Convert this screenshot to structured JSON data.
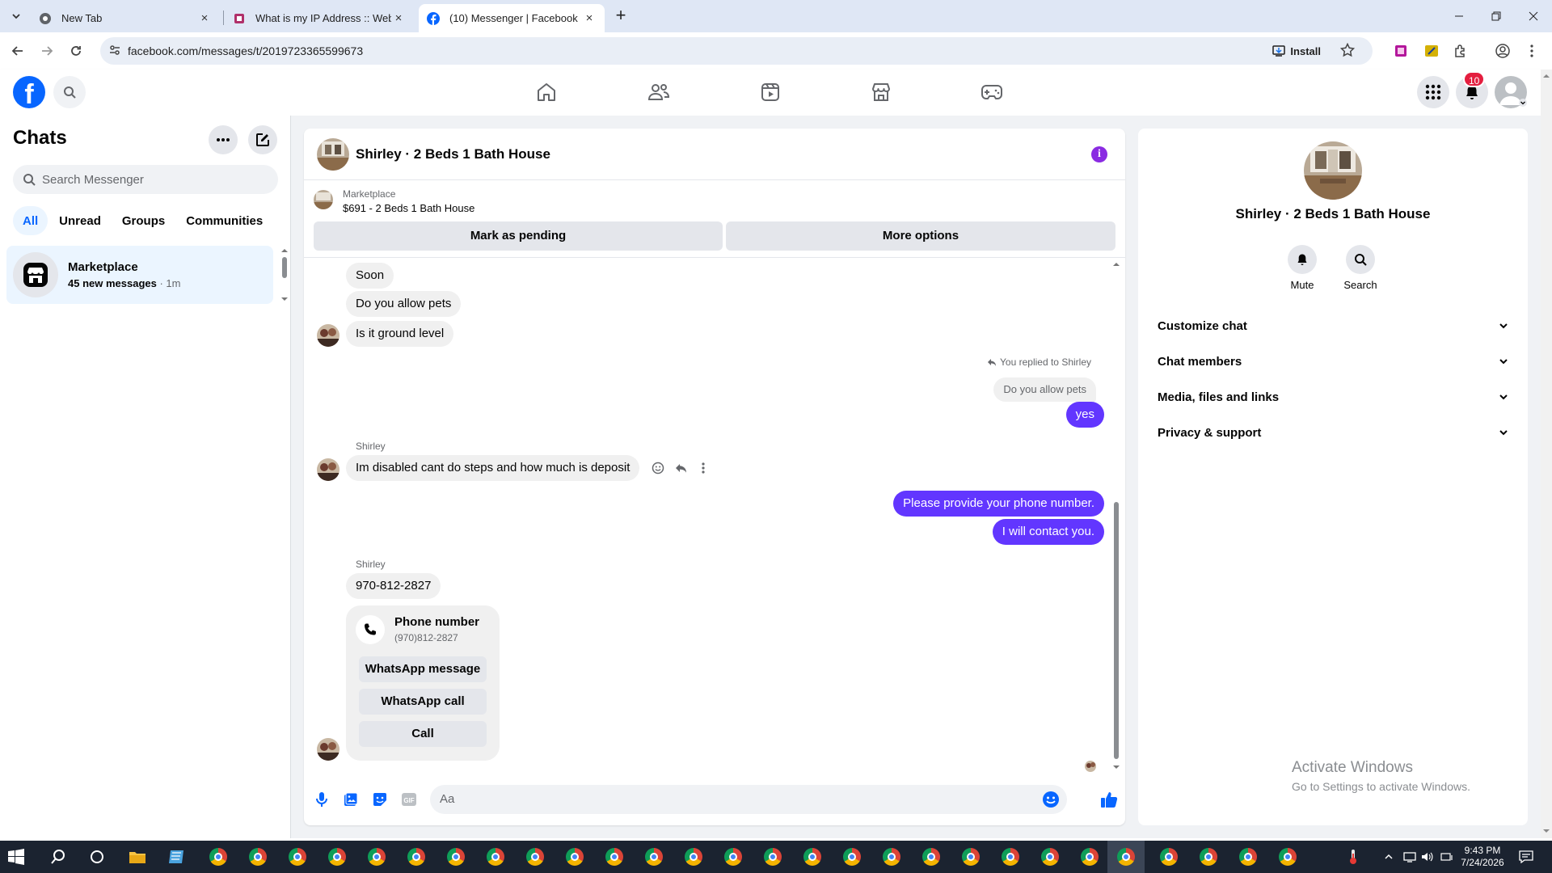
{
  "browser": {
    "tabs": [
      {
        "title": "New Tab",
        "active": false
      },
      {
        "title": "What is my IP Address :: WebBr",
        "active": false
      },
      {
        "title": "(10) Messenger | Facebook",
        "active": true
      }
    ],
    "new_tab_symbol": "+",
    "close_symbol": "×",
    "url": "facebook.com/messages/t/2019723365599673",
    "install_label": "Install"
  },
  "header": {
    "logo_text": "f",
    "notifications_count": "10",
    "nav_icons": [
      "home-icon",
      "friends-icon",
      "video-icon",
      "marketplace-icon",
      "gaming-icon"
    ]
  },
  "sidebar": {
    "title": "Chats",
    "search_placeholder": "Search Messenger",
    "filters": [
      "All",
      "Unread",
      "Groups",
      "Communities"
    ],
    "active_filter": "All",
    "chats": [
      {
        "name": "Marketplace",
        "preview": "45 new messages",
        "time": "· 1m"
      }
    ]
  },
  "conversation": {
    "title": "Shirley · 2 Beds 1 Bath House",
    "marketplace_label": "Marketplace",
    "listing": "$691 - 2 Beds 1 Bath House",
    "mark_pending_label": "Mark as pending",
    "more_options_label": "More options",
    "messages": {
      "m1": "Soon",
      "m2": "Do you allow pets",
      "m3": "Is it ground level",
      "replied_label": "You replied to Shirley",
      "quoted": "Do you allow pets",
      "reply": "yes",
      "sender1": "Shirley",
      "m4": "Im disabled cant do steps and how much is deposit",
      "me1": "Please provide your phone number.",
      "me2": "I will contact you.",
      "sender2": "Shirley",
      "m5": "970-812-2827"
    },
    "phone_card": {
      "title": "Phone number",
      "number": "(970)812-2827",
      "whatsapp_message": "WhatsApp message",
      "whatsapp_call": "WhatsApp call",
      "call": "Call"
    },
    "composer_placeholder": "Aa"
  },
  "info_panel": {
    "name": "Shirley · 2 Beds 1 Bath House",
    "actions": [
      "Mute",
      "Search"
    ],
    "sections": [
      "Customize chat",
      "Chat members",
      "Media, files and links",
      "Privacy & support"
    ]
  },
  "watermark": {
    "line1": "Activate Windows",
    "line2": "Go to Settings to activate Windows."
  },
  "taskbar": {
    "time": "9:43 PM",
    "date": "7/24/2026"
  },
  "colors": {
    "facebook_blue": "#0866ff",
    "my_bubble": "#6236ff",
    "badge_red": "#e41e3f"
  }
}
